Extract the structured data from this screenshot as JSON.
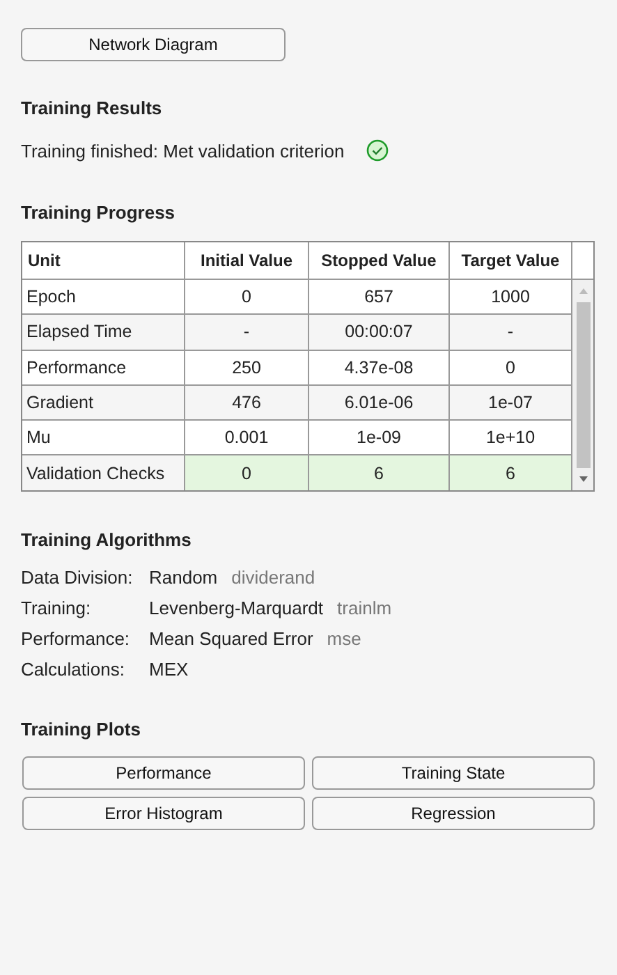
{
  "network_diagram_button": "Network Diagram",
  "training_results": {
    "title": "Training Results",
    "status": "Training finished: Met validation criterion",
    "success": true
  },
  "training_progress": {
    "title": "Training Progress",
    "columns": [
      "Unit",
      "Initial Value",
      "Stopped Value",
      "Target Value"
    ],
    "rows": [
      {
        "cells": [
          "Epoch",
          "0",
          "657",
          "1000"
        ],
        "highlighted": false
      },
      {
        "cells": [
          "Elapsed Time",
          "-",
          "00:00:07",
          "-"
        ],
        "highlighted": false
      },
      {
        "cells": [
          "Performance",
          "250",
          "4.37e-08",
          "0"
        ],
        "highlighted": false
      },
      {
        "cells": [
          "Gradient",
          "476",
          "6.01e-06",
          "1e-07"
        ],
        "highlighted": false
      },
      {
        "cells": [
          "Mu",
          "0.001",
          "1e-09",
          "1e+10"
        ],
        "highlighted": false
      },
      {
        "cells": [
          "Validation Checks",
          "0",
          "6",
          "6"
        ],
        "highlighted": true
      }
    ]
  },
  "training_algorithms": {
    "title": "Training Algorithms",
    "items": [
      {
        "label": "Data Division:",
        "value": "Random",
        "function": "dividerand"
      },
      {
        "label": "Training:",
        "value": "Levenberg-Marquardt",
        "function": "trainlm"
      },
      {
        "label": "Performance:",
        "value": "Mean Squared Error",
        "function": "mse"
      },
      {
        "label": "Calculations:",
        "value": "MEX"
      }
    ]
  },
  "training_plots": {
    "title": "Training Plots",
    "buttons": [
      "Performance",
      "Training State",
      "Error Histogram",
      "Regression"
    ]
  }
}
